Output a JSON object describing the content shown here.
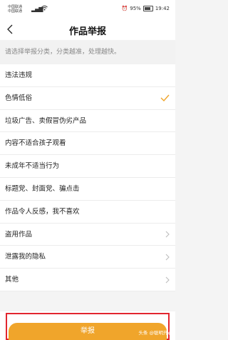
{
  "status_bar": {
    "carrier_1": "中国联通",
    "carrier_2": "中国联通",
    "battery": "95%",
    "time": "19:42"
  },
  "header": {
    "title": "作品举报"
  },
  "hint": "请选择举报分类，分类越准，处理越快。",
  "reasons": [
    {
      "label": "违法违规",
      "indicator": ""
    },
    {
      "label": "色情低俗",
      "indicator": "checkmark"
    },
    {
      "label": "垃圾广告、卖假冒伪劣产品",
      "indicator": ""
    },
    {
      "label": "内容不适合孩子观看",
      "indicator": ""
    },
    {
      "label": "未成年不适当行为",
      "indicator": ""
    },
    {
      "label": "标题党、封面党、骗点击",
      "indicator": ""
    },
    {
      "label": "作品令人反感，我不喜欢",
      "indicator": ""
    },
    {
      "label": "盗用作品",
      "indicator": "chevron"
    },
    {
      "label": "泄露我的隐私",
      "indicator": "chevron"
    },
    {
      "label": "其他",
      "indicator": "chevron"
    }
  ],
  "submit_label": "举报",
  "watermark": "头条 @聪明开心",
  "colors": {
    "accent": "#f0a52b",
    "highlight_frame": "#e2262f"
  }
}
